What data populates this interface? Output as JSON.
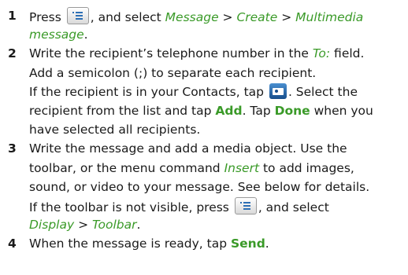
{
  "steps": [
    {
      "number": "1",
      "lines": [
        {
          "parts": [
            "Press ",
            {
              "icon": "menu-key-icon"
            },
            ", and select ",
            {
              "link": "Message"
            },
            " > ",
            {
              "link": "Create"
            },
            " > ",
            {
              "link": "Multimedia"
            }
          ]
        },
        {
          "parts": [
            {
              "link": "message"
            },
            "."
          ]
        }
      ]
    },
    {
      "number": "2",
      "lines": [
        {
          "parts": [
            "Write the recipient’s telephone number in the ",
            {
              "link": "To:"
            },
            " field."
          ]
        },
        {
          "parts": [
            "Add a semicolon (;) to separate each recipient."
          ]
        },
        {
          "parts": [
            "If the recipient is in your Contacts, tap ",
            {
              "icon": "contacts-icon"
            },
            ". Select the"
          ]
        },
        {
          "parts": [
            "recipient from the list and tap ",
            {
              "bold": "Add"
            },
            ". Tap ",
            {
              "bold": "Done"
            },
            " when you"
          ]
        },
        {
          "parts": [
            "have selected all recipients."
          ]
        }
      ]
    },
    {
      "number": "3",
      "lines": [
        {
          "parts": [
            "Write the message and add a media object. Use the"
          ]
        },
        {
          "parts": [
            "toolbar, or the menu command ",
            {
              "link": "Insert"
            },
            " to add images,"
          ]
        },
        {
          "parts": [
            "sound, or video to your message. See below for details."
          ]
        },
        {
          "parts": [
            "If the toolbar is not visible, press ",
            {
              "icon": "menu-key-icon"
            },
            ", and select"
          ]
        },
        {
          "parts": [
            {
              "link": "Display"
            },
            " > ",
            {
              "link": "Toolbar"
            },
            "."
          ]
        }
      ]
    },
    {
      "number": "4",
      "lines": [
        {
          "parts": [
            "When the message is ready, tap ",
            {
              "bold": "Send"
            },
            "."
          ]
        }
      ]
    }
  ]
}
